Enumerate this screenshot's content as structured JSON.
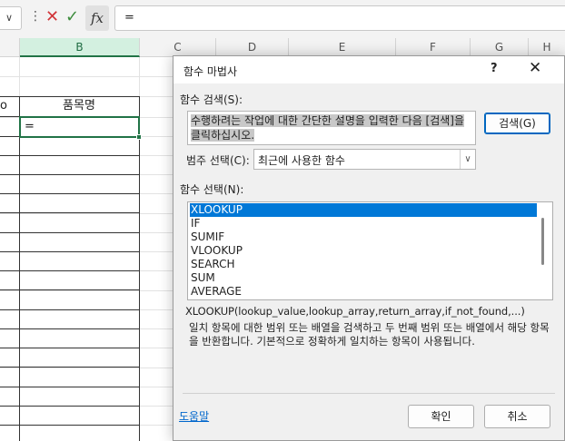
{
  "formula_bar": {
    "name_box_arrow": "∨",
    "menu_dots": "⋮",
    "cancel_glyph": "✕",
    "enter_glyph": "✓",
    "fx_label": "fx",
    "formula_value": "="
  },
  "sheet": {
    "columns": [
      {
        "label": "B",
        "selected": true
      },
      {
        "label": "C",
        "selected": false
      },
      {
        "label": "D",
        "selected": false
      },
      {
        "label": "E",
        "selected": false
      },
      {
        "label": "F",
        "selected": false
      },
      {
        "label": "G",
        "selected": false
      },
      {
        "label": "H",
        "selected": false
      }
    ],
    "left_cut_header": "o",
    "header_cell": "품목명",
    "active_cell_value": "="
  },
  "dialog": {
    "title": "함수 마법사",
    "help_glyph": "?",
    "close_glyph": "✕",
    "search_label": "함수 검색(S):",
    "search_value": "수행하려는 작업에 대한 간단한 설명을 입력한 다음 [검색]을 클릭하십시오.",
    "search_button": "검색(G)",
    "category_label": "범주 선택(C):",
    "category_value": "최근에 사용한 함수",
    "function_list_label": "함수 선택(N):",
    "functions": [
      "XLOOKUP",
      "IF",
      "SUMIF",
      "VLOOKUP",
      "SEARCH",
      "SUM",
      "AVERAGE"
    ],
    "selected_function": "XLOOKUP",
    "signature": "XLOOKUP(lookup_value,lookup_array,return_array,if_not_found,...)",
    "description": "일치 항목에 대한 범위 또는 배열을 검색하고 두 번째 범위 또는 배열에서 해당 항목을 반환합니다. 기본적으로 정확하게 일치하는 항목이 사용됩니다.",
    "help_link": "도움말",
    "ok_button": "확인",
    "cancel_button": "취소"
  }
}
